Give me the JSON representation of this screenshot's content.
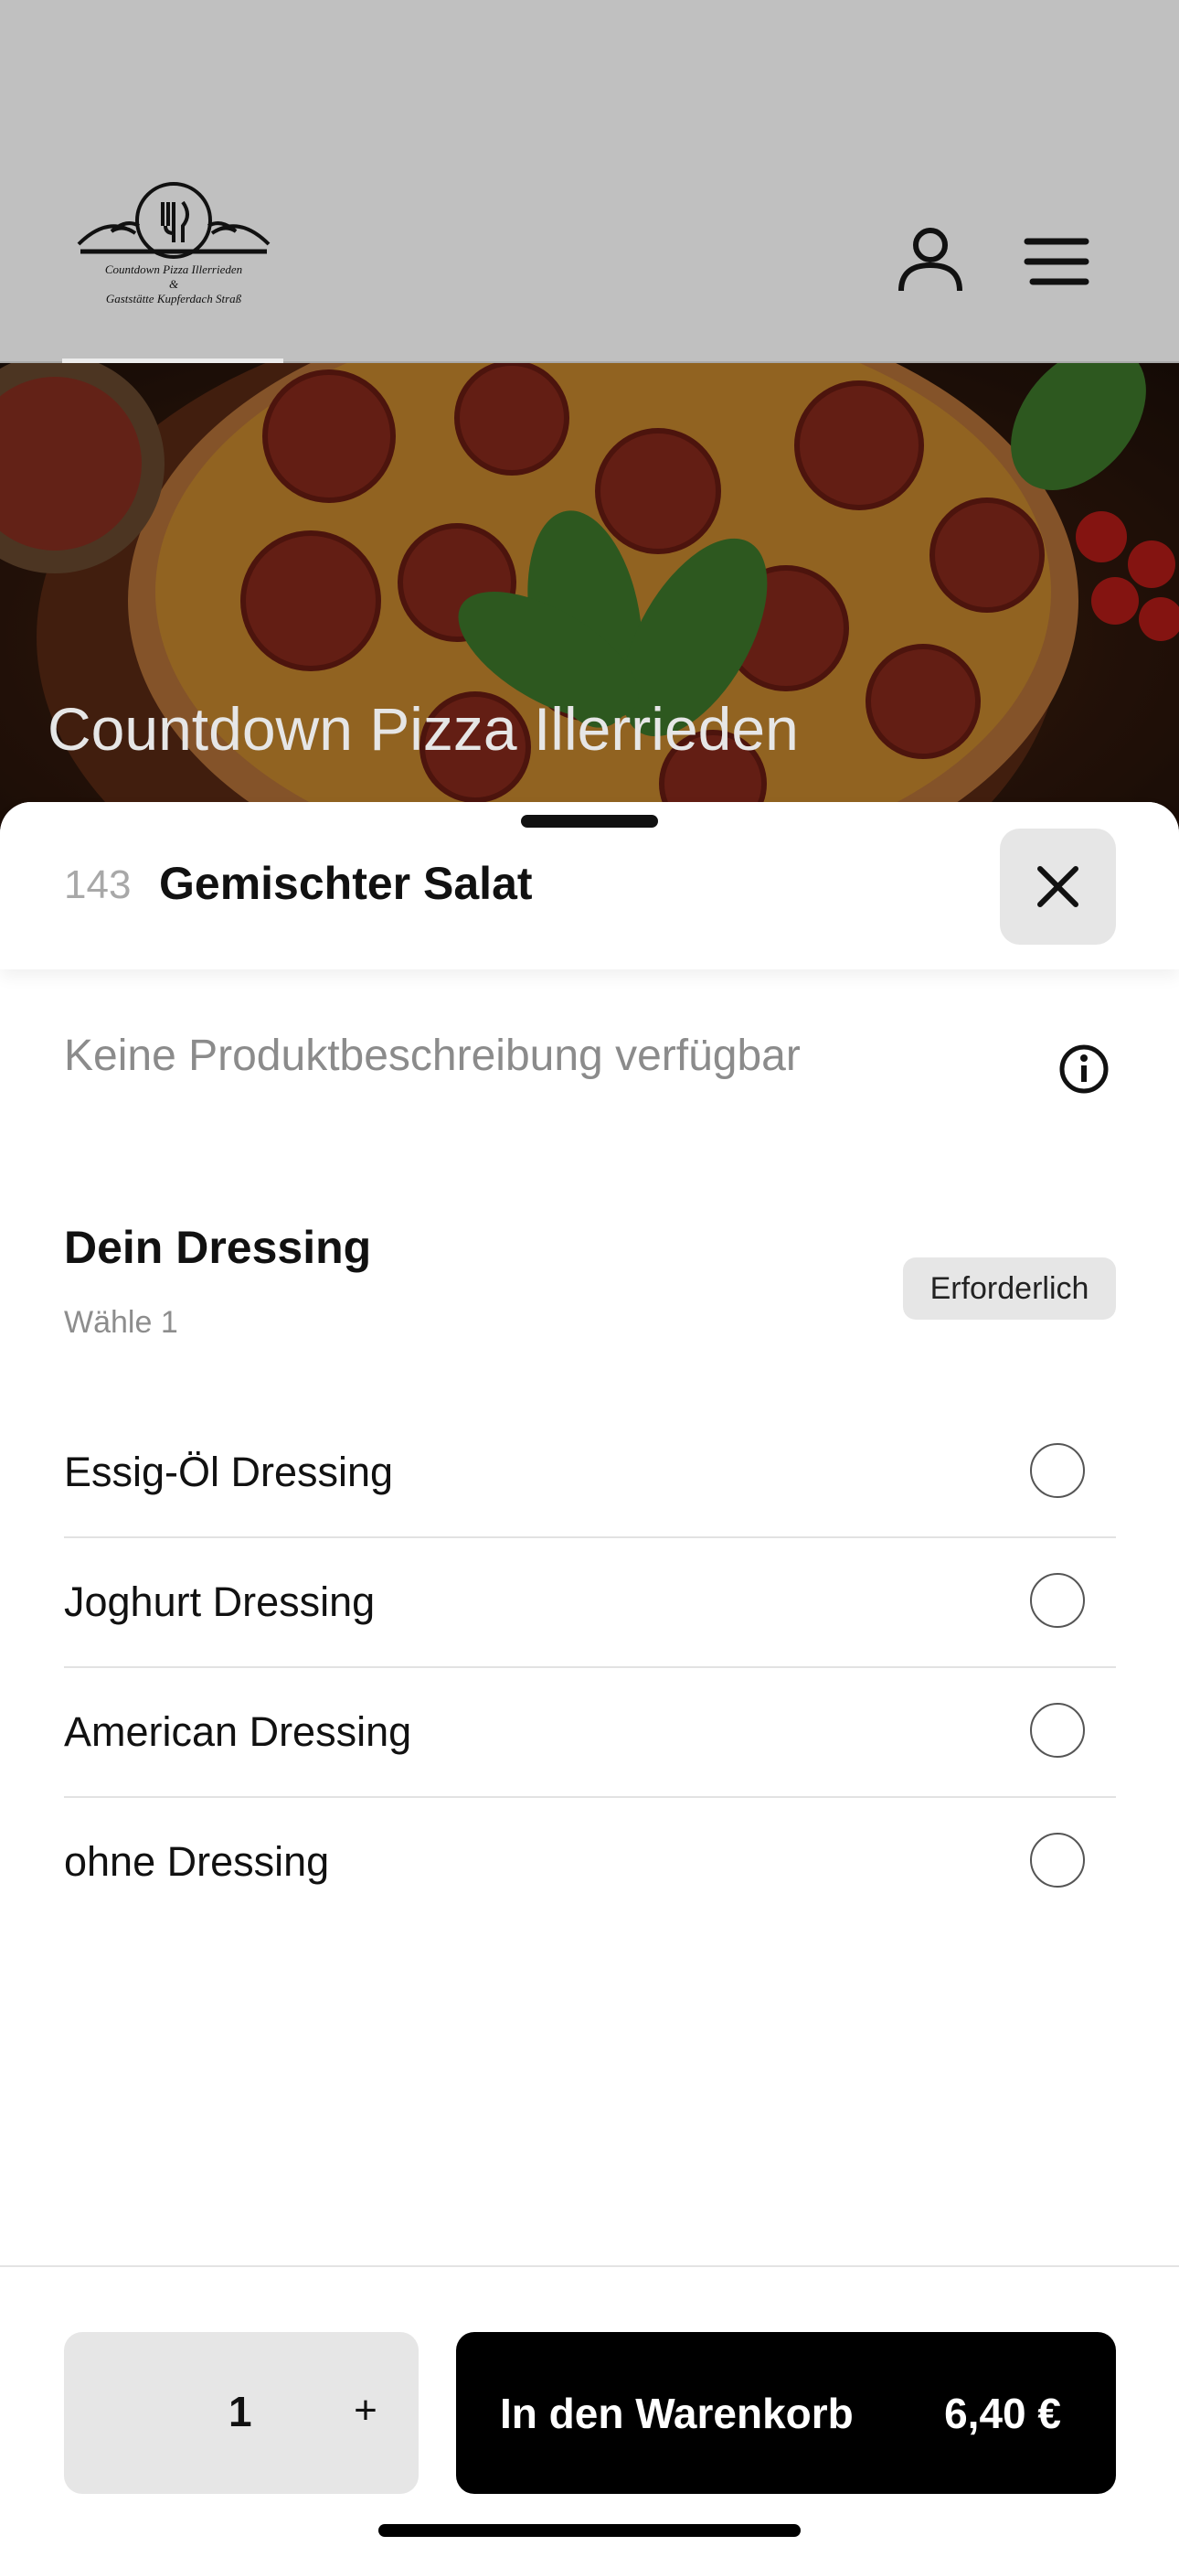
{
  "header": {
    "logo": {
      "line1": "Countdown Pizza Illerrieden",
      "line2": "&",
      "line3": "Gaststätte Kupferdach Straß"
    },
    "account_icon": "person-icon",
    "menu_icon": "hamburger-menu-icon"
  },
  "hero": {
    "title": "Countdown Pizza Illerrieden"
  },
  "sheet": {
    "product_number": "143",
    "product_name": "Gemischter Salat",
    "close_icon": "close-icon",
    "description": "Keine Produktbeschreibung verfügbar",
    "info_icon": "info-icon",
    "option_group": {
      "title": "Dein Dressing",
      "subtitle": "Wähle 1",
      "badge": "Erforderlich",
      "options": [
        {
          "label": "Essig-Öl Dressing",
          "selected": false
        },
        {
          "label": "Joghurt Dressing",
          "selected": false
        },
        {
          "label": "American Dressing",
          "selected": false
        },
        {
          "label": "ohne Dressing",
          "selected": false
        }
      ]
    }
  },
  "footer": {
    "quantity": "1",
    "plus_label": "+",
    "cart_label": "In den Warenkorb",
    "price": "6,40 €"
  },
  "colors": {
    "accent": "#000000",
    "dim_overlay": "#c0c0c0",
    "badge_bg": "#e6e6e6"
  }
}
